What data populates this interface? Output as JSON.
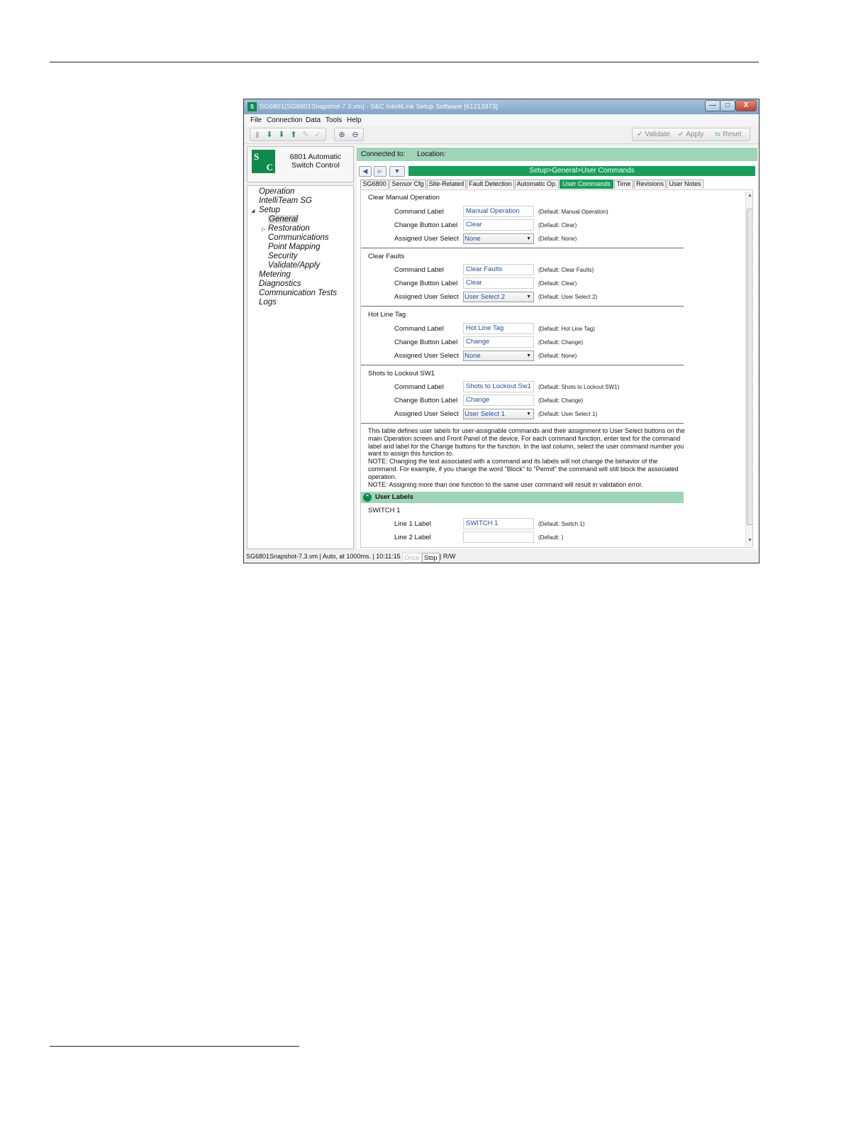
{
  "window": {
    "title": "SG6801(SG6801Snapshot-7.3.vm) - S&C IntelliLink Setup Software [61213373]",
    "min_glyph": "—",
    "max_glyph": "□",
    "close_glyph": "X"
  },
  "menu": [
    "File",
    "Connection",
    "Data",
    "Tools",
    "Help"
  ],
  "toolbar": {
    "validate": "Validate",
    "apply": "Apply",
    "reset": "Reset"
  },
  "brand": {
    "logo_top": "S",
    "logo_bottom": "C",
    "line1": "6801 Automatic",
    "line2": "Switch Control"
  },
  "tree": {
    "operation": "Operation",
    "intelliteam": "IntelliTeam SG",
    "setup": "Setup",
    "general": "General",
    "restoration": "Restoration",
    "communications": "Communications",
    "point_mapping": "Point Mapping",
    "security": "Security",
    "validate_apply": "Validate/Apply",
    "metering": "Metering",
    "diagnostics": "Diagnostics",
    "communication_tests": "Communication Tests",
    "logs": "Logs"
  },
  "connection": {
    "connected_to": "Connected to:",
    "location": "Location:"
  },
  "breadcrumb": "Setup>General>User Commands",
  "tabs": [
    "SG6800",
    "Sensor Cfg",
    "Site-Related",
    "Fault Detection",
    "Automatic Op.",
    "User Commands",
    "Time",
    "Revisions",
    "User Notes"
  ],
  "labels": {
    "command_label": "Command Label",
    "change_button_label": "Change Button Label",
    "assigned_user_select": "Assigned User Select"
  },
  "sections": {
    "clear_manual": {
      "title": "Clear Manual Operation",
      "command": "Manual Operation",
      "command_default": "(Default: Manual Operation)",
      "button": "Clear",
      "button_default": "(Default: Clear)",
      "select": "None",
      "select_default": "(Default: None)"
    },
    "clear_faults": {
      "title": "Clear Faults",
      "command": "Clear Faults",
      "command_default": "(Default: Clear Faults)",
      "button": "Clear",
      "button_default": "(Default: Clear)",
      "select": "User Select 2",
      "select_default": "(Default: User Select 2)"
    },
    "hot_line_tag": {
      "title": "Hot Line Tag",
      "command": "Hot Line Tag",
      "command_default": "(Default: Hot Line Tag)",
      "button": "Change",
      "button_default": "(Default: Change)",
      "select": "None",
      "select_default": "(Default: None)"
    },
    "shots_lockout": {
      "title": "Shots to Lockout SW1",
      "command": "Shots to Lockout Sw1",
      "command_default": "(Default: Shots to Lockout SW1)",
      "button": "Change",
      "button_default": "(Default: Change)",
      "select": "User Select 1",
      "select_default": "(Default: User Select 1)"
    }
  },
  "description": [
    "This table defines user labels for user-assignable commands and their assignment to User Select buttons on the main Operation screen and Front Panel of the device. For each command function, enter text for the command label and label for the Change buttons for the function. In the last column, select the user command number you want to assign this function to.",
    "NOTE: Changing the text associated with a command and its labels will not change the behavior of the command.  For example, if you change the word \"Block\" to \"Permit\" the command will still block the associated operation.",
    "NOTE: Assigning more than one function to the same user command will result in validation error."
  ],
  "user_labels": {
    "header": "User Labels",
    "switch_title": "SWITCH 1",
    "line1_label": "Line 1 Label",
    "line1_value": "SWITCH 1",
    "line1_default": "(Default: Switch 1)",
    "line2_label": "Line 2 Label",
    "line2_value": "",
    "line2_default": "(Default: )"
  },
  "status": {
    "text": "SG6801Snapshot-7.3.vm | Auto, at 1000ms. | 10:11:15 AM",
    "once": "Once",
    "stop": "Stop",
    "mode": "| R/W"
  },
  "colors": {
    "accent_green": "#16a05a",
    "light_green": "#9ed4b7",
    "field_text_blue": "#1f4f9f"
  }
}
